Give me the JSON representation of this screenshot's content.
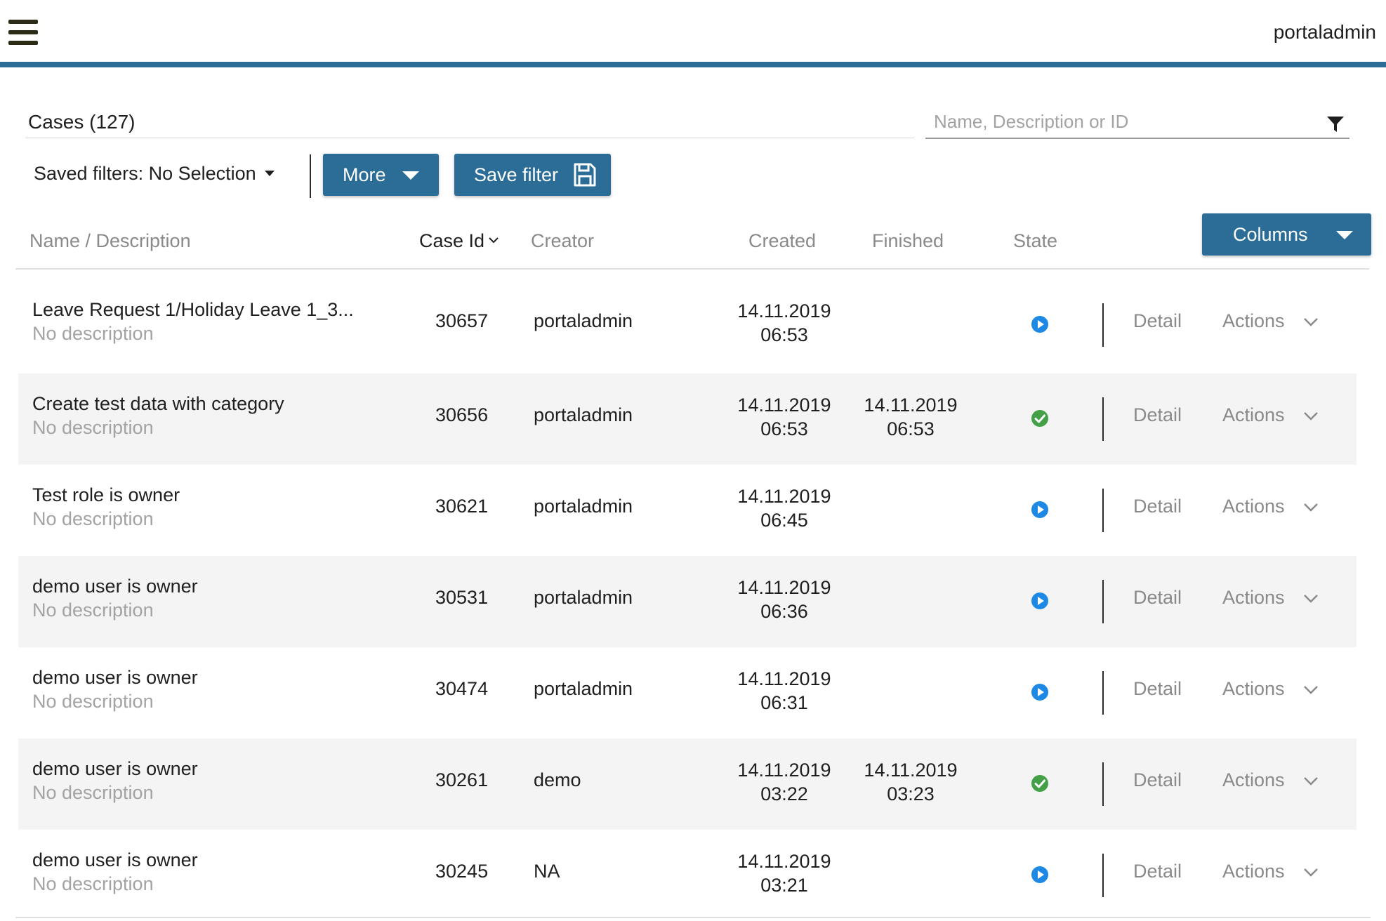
{
  "header": {
    "user_name": "portaladmin"
  },
  "cases": {
    "title": "Cases (127)",
    "search_placeholder": "Name, Description or ID",
    "saved_filters_label": "Saved filters: No Selection",
    "more_label": "More",
    "save_filter_label": "Save filter",
    "columns_label": "Columns"
  },
  "table": {
    "headers": {
      "name": "Name / Description",
      "case_id": "Case Id",
      "creator": "Creator",
      "created": "Created",
      "finished": "Finished",
      "state": "State"
    },
    "rows": [
      {
        "name": "Leave Request 1/Holiday Leave 1_3...",
        "description": "No description",
        "case_id": "30657",
        "creator": "portaladmin",
        "created_date": "14.11.2019",
        "created_time": "06:53",
        "finished_date": "",
        "finished_time": "",
        "state": "running",
        "detail": "Detail",
        "actions": "Actions"
      },
      {
        "name": "Create test data with category",
        "description": "No description",
        "case_id": "30656",
        "creator": "portaladmin",
        "created_date": "14.11.2019",
        "created_time": "06:53",
        "finished_date": "14.11.2019",
        "finished_time": "06:53",
        "state": "done",
        "detail": "Detail",
        "actions": "Actions"
      },
      {
        "name": "Test role is owner",
        "description": "No description",
        "case_id": "30621",
        "creator": "portaladmin",
        "created_date": "14.11.2019",
        "created_time": "06:45",
        "finished_date": "",
        "finished_time": "",
        "state": "running",
        "detail": "Detail",
        "actions": "Actions"
      },
      {
        "name": "demo user is owner",
        "description": "No description",
        "case_id": "30531",
        "creator": "portaladmin",
        "created_date": "14.11.2019",
        "created_time": "06:36",
        "finished_date": "",
        "finished_time": "",
        "state": "running",
        "detail": "Detail",
        "actions": "Actions"
      },
      {
        "name": "demo user is owner",
        "description": "No description",
        "case_id": "30474",
        "creator": "portaladmin",
        "created_date": "14.11.2019",
        "created_time": "06:31",
        "finished_date": "",
        "finished_time": "",
        "state": "running",
        "detail": "Detail",
        "actions": "Actions"
      },
      {
        "name": "demo user is owner",
        "description": "No description",
        "case_id": "30261",
        "creator": "demo",
        "created_date": "14.11.2019",
        "created_time": "03:22",
        "finished_date": "14.11.2019",
        "finished_time": "03:23",
        "state": "done",
        "detail": "Detail",
        "actions": "Actions"
      },
      {
        "name": "demo user is owner",
        "description": "No description",
        "case_id": "30245",
        "creator": "NA",
        "created_date": "14.11.2019",
        "created_time": "03:21",
        "finished_date": "",
        "finished_time": "",
        "state": "running",
        "detail": "Detail",
        "actions": "Actions"
      }
    ]
  },
  "colors": {
    "accent": "#2b6d97",
    "running": "#1e88e5",
    "done": "#43a047",
    "row_alt": "#f4f4f4"
  },
  "icons": {
    "menu": "hamburger-icon",
    "filter": "funnel-icon",
    "save": "floppy-disk-icon",
    "running": "play-circle-icon",
    "done": "check-circle-icon"
  }
}
